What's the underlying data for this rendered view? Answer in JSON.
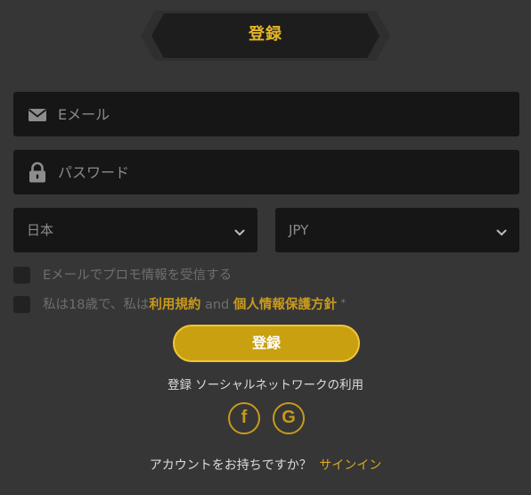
{
  "header": {
    "title": "登録"
  },
  "form": {
    "email": {
      "placeholder": "Eメール",
      "value": "",
      "icon": "mail-icon"
    },
    "password": {
      "placeholder": "パスワード",
      "value": "",
      "icon": "lock-icon"
    },
    "country": {
      "value": "日本"
    },
    "currency": {
      "value": "JPY"
    },
    "promo_checkbox": {
      "label": "Eメールでプロモ情報を受信する",
      "checked": false
    },
    "terms_checkbox": {
      "label_prefix": "私は18歳で、私は",
      "terms_link": "利用規約",
      "conjunction": " and ",
      "privacy_link": "個人情報保護方針",
      "required_mark": "*",
      "checked": false
    },
    "submit_label": "登録"
  },
  "social": {
    "caption": "登録 ソーシャルネットワークの利用",
    "facebook_icon": "facebook-icon",
    "google_icon": "google-icon",
    "facebook_glyph": "f",
    "google_glyph": "G"
  },
  "signin": {
    "question": "アカウントをお持ちですか？",
    "link": "サインイン"
  },
  "colors": {
    "background": "#363636",
    "field": "#161616",
    "accent": "#e6b527",
    "button": "#c9a010"
  }
}
